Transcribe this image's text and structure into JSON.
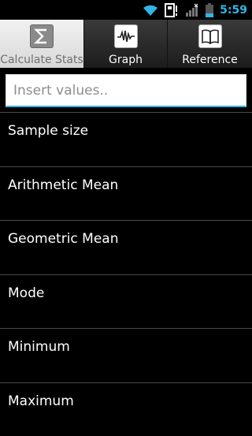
{
  "status_bar": {
    "time": "5:59",
    "accent": "#33b5e5",
    "icons": [
      "wifi-icon",
      "sim-card-icon",
      "signal-icon",
      "battery-icon"
    ]
  },
  "tabs": [
    {
      "label": "Calculate Stats",
      "icon": "sigma-icon",
      "active": true
    },
    {
      "label": "Graph",
      "icon": "waveform-icon",
      "active": false
    },
    {
      "label": "Reference",
      "icon": "book-icon",
      "active": false
    }
  ],
  "input": {
    "placeholder": "Insert values..",
    "value": ""
  },
  "stats": [
    {
      "label": "Sample size"
    },
    {
      "label": "Arithmetic Mean"
    },
    {
      "label": "Geometric Mean"
    },
    {
      "label": "Mode"
    },
    {
      "label": "Minimum"
    },
    {
      "label": "Maximum"
    }
  ]
}
